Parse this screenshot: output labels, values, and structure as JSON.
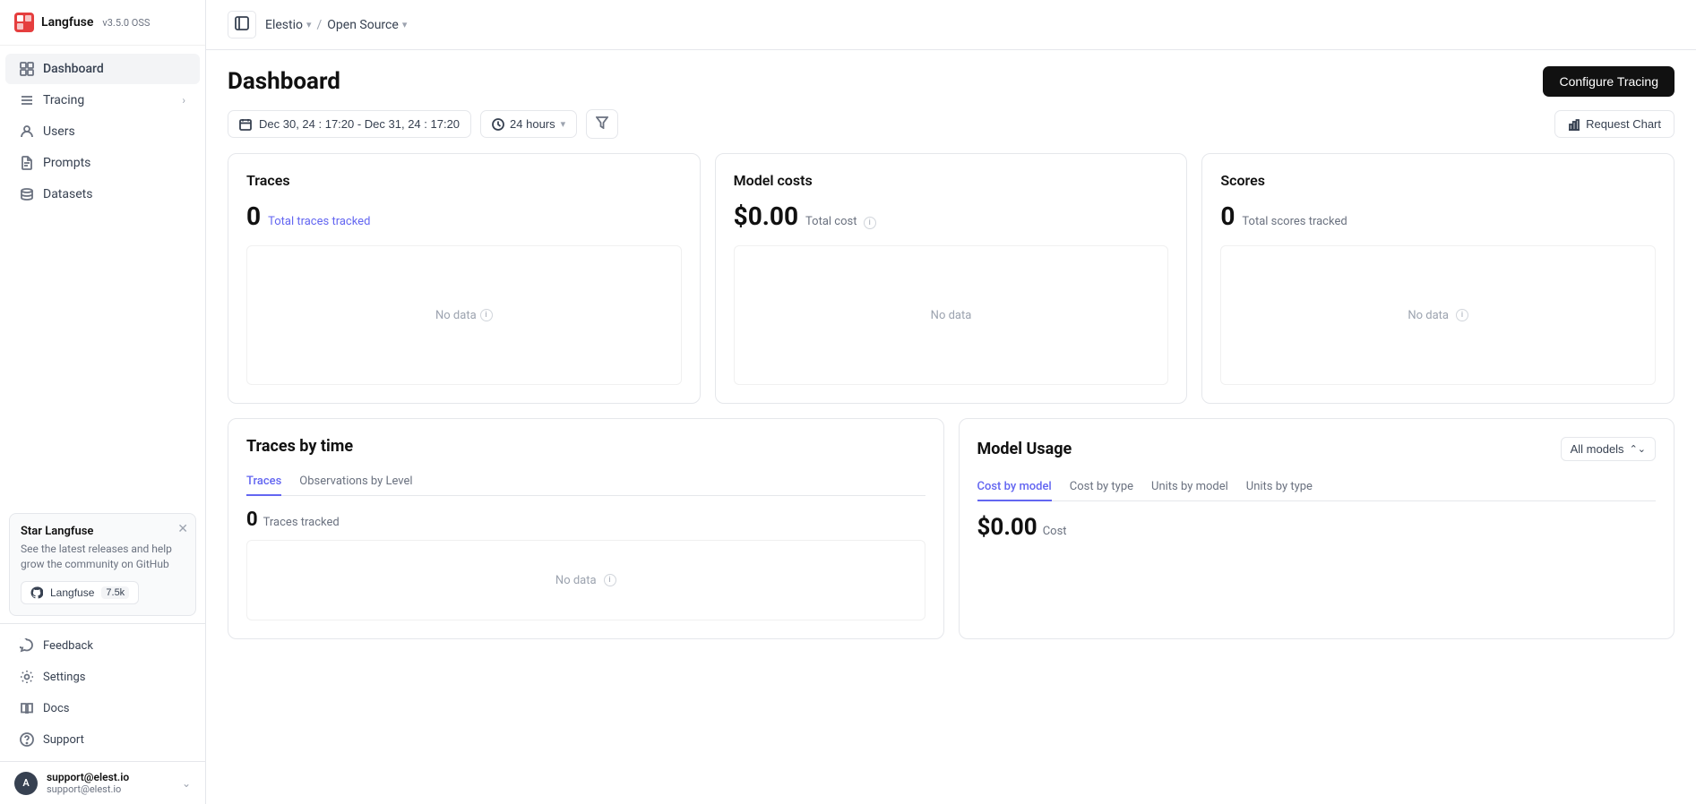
{
  "app": {
    "name": "Langfuse",
    "version": "v3.5.0 OSS",
    "upgrade_icon": "↑"
  },
  "sidebar": {
    "nav_items": [
      {
        "id": "dashboard",
        "label": "Dashboard",
        "icon": "grid",
        "active": true,
        "chevron": false
      },
      {
        "id": "tracing",
        "label": "Tracing",
        "icon": "list",
        "active": false,
        "chevron": true
      },
      {
        "id": "users",
        "label": "Users",
        "icon": "user",
        "active": false,
        "chevron": false
      },
      {
        "id": "prompts",
        "label": "Prompts",
        "icon": "file-text",
        "active": false,
        "chevron": false
      },
      {
        "id": "datasets",
        "label": "Datasets",
        "icon": "database",
        "active": false,
        "chevron": false
      }
    ],
    "bottom_items": [
      {
        "id": "feedback",
        "label": "Feedback",
        "icon": "message-circle"
      },
      {
        "id": "settings",
        "label": "Settings",
        "icon": "settings"
      },
      {
        "id": "docs",
        "label": "Docs",
        "icon": "book-open"
      },
      {
        "id": "support",
        "label": "Support",
        "icon": "help-circle"
      }
    ],
    "star_card": {
      "title": "Star Langfuse",
      "description": "See the latest releases and help grow the community on GitHub",
      "button_label": "Langfuse",
      "star_count": "7.5k"
    },
    "user": {
      "avatar": "A",
      "name": "support@elest.io",
      "email": "support@elest.io"
    }
  },
  "topbar": {
    "org_name": "Elestio",
    "project_name": "Open Source",
    "sidebar_icon": "sidebar"
  },
  "page": {
    "title": "Dashboard",
    "configure_btn": "Configure Tracing"
  },
  "filters": {
    "date_range": "Dec 30, 24 : 17:20 - Dec 31, 24 : 17:20",
    "time_filter": "24 hours",
    "request_chart_btn": "Request Chart"
  },
  "stats": {
    "traces": {
      "title": "Traces",
      "value": "0",
      "subtitle": "Total traces tracked",
      "no_data": "No data"
    },
    "model_costs": {
      "title": "Model costs",
      "value": "$0.00",
      "subtitle": "Total cost",
      "no_data": "No data"
    },
    "scores": {
      "title": "Scores",
      "value": "0",
      "subtitle": "Total scores tracked",
      "no_data": "No data"
    }
  },
  "traces_by_time": {
    "title": "Traces by time",
    "tabs": [
      {
        "id": "traces",
        "label": "Traces",
        "active": true
      },
      {
        "id": "observations",
        "label": "Observations by Level",
        "active": false
      }
    ],
    "value": "0",
    "subtitle": "Traces tracked",
    "no_data": "No data"
  },
  "model_usage": {
    "title": "Model Usage",
    "select_label": "All models",
    "tabs": [
      {
        "id": "cost-by-model",
        "label": "Cost by model",
        "active": true
      },
      {
        "id": "cost-by-type",
        "label": "Cost by type",
        "active": false
      },
      {
        "id": "units-by-model",
        "label": "Units by model",
        "active": false
      },
      {
        "id": "units-by-type",
        "label": "Units by type",
        "active": false
      }
    ],
    "value": "$0.00",
    "subtitle": "Cost"
  }
}
